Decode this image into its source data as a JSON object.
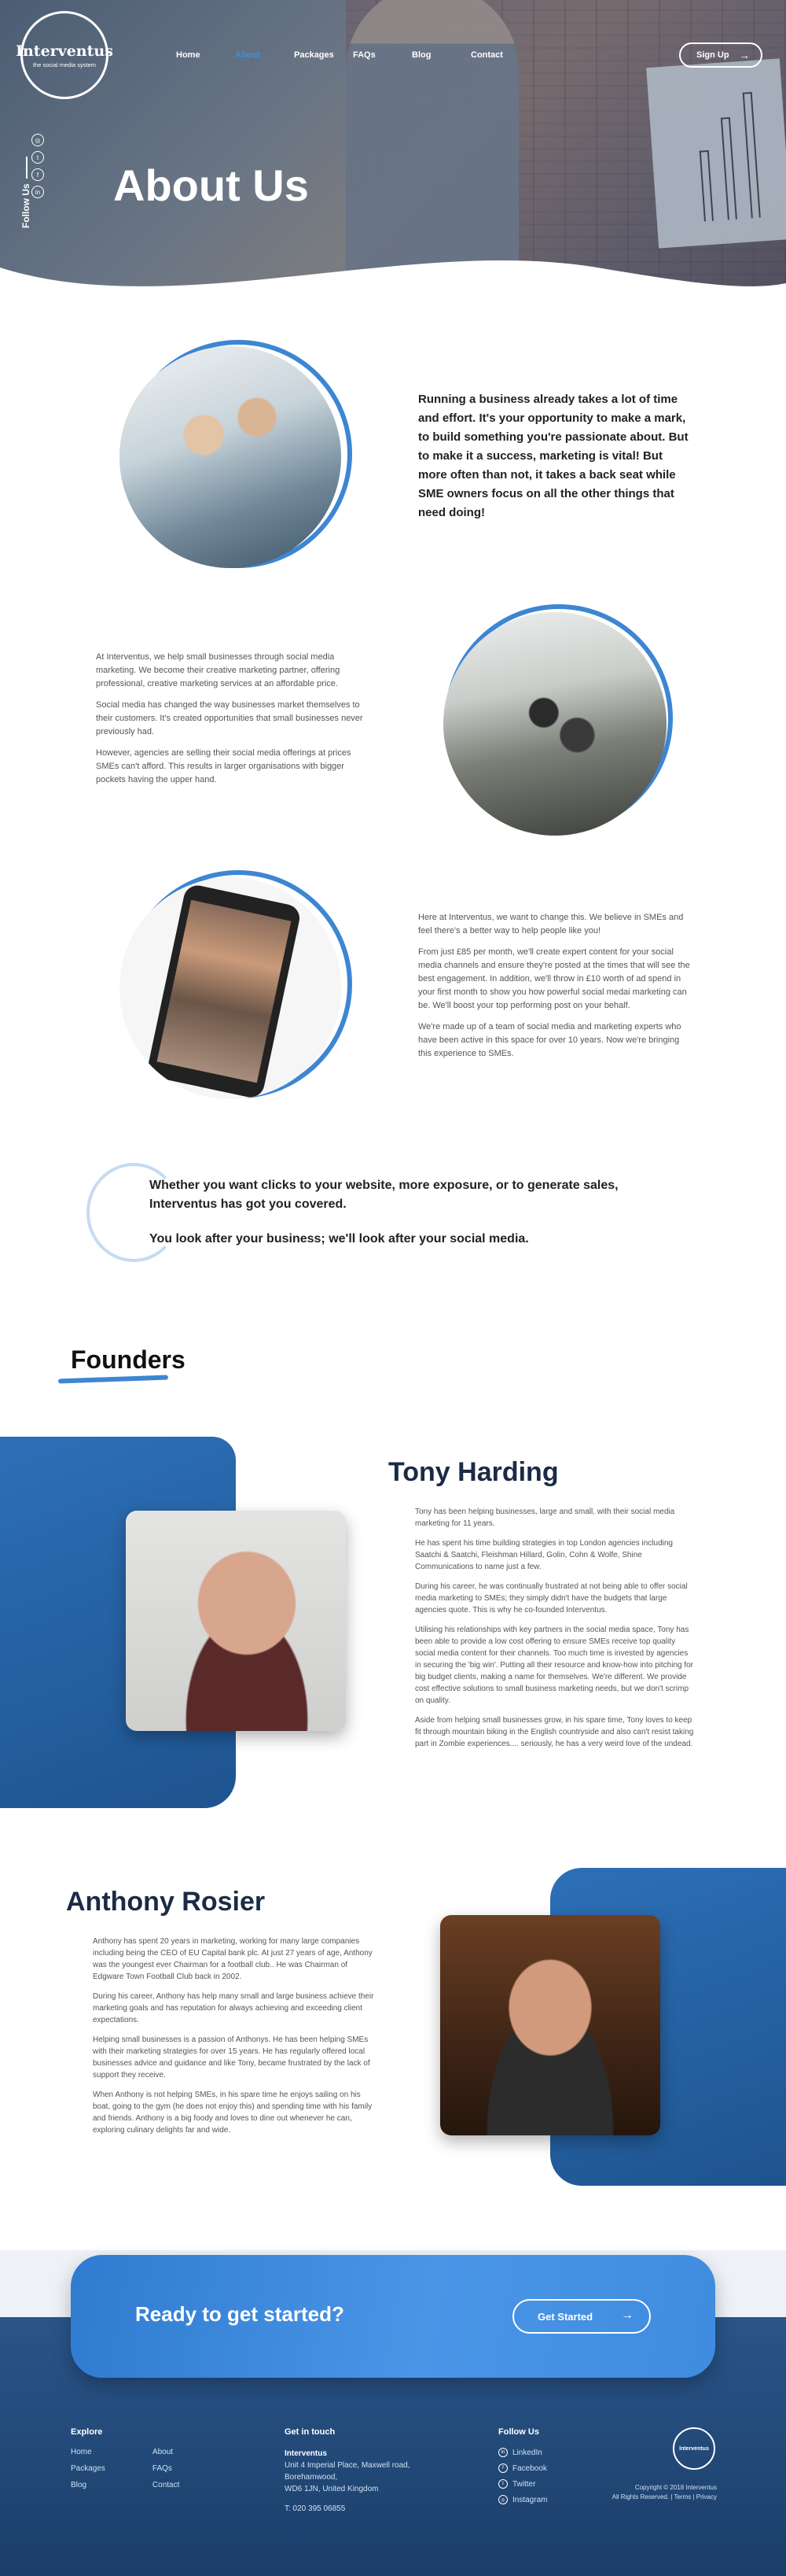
{
  "brand": {
    "name": "Interventus",
    "tagline": "the social media system"
  },
  "nav": [
    "Home",
    "About",
    "Packages",
    "FAQs",
    "Blog",
    "Contact"
  ],
  "nav_active": "About",
  "signup_label": "Sign Up",
  "follow_label": "Follow Us",
  "hero_title": "About Us",
  "intro_lead": "Running a business already takes a lot of time and effort. It's your opportunity to make a mark, to build something you're passionate about. But to make it a success, marketing is vital! But more often than not, it takes a back seat while SME owners focus on all the other things that need doing!",
  "section2": [
    "At Interventus, we help small businesses through social media marketing. We become their creative marketing partner, offering professional, creative marketing services at an affordable price.",
    "Social media has changed the way businesses market themselves to their customers. It's created opportunities that small businesses never previously had.",
    "However, agencies are selling their social media offerings at prices SMEs can't afford. This results in larger organisations with bigger pockets having the upper hand."
  ],
  "section3": [
    "Here at Interventus, we want to change this. We believe in SMEs and feel there's a better way to help people like you!",
    "From just £85 per month, we'll create expert content for your social media channels and ensure they're posted at the times that will see the best engagement. In addition, we'll throw in £10 worth of ad spend in your first month to show you how powerful social medai marketing can be. We'll boost your top performing post on your behalf.",
    "We're made up of a team of social media and marketing experts who have been active in this space for over 10 years. Now we're bringing this experience to SMEs."
  ],
  "quote": [
    "Whether you want clicks to your website, more exposure, or to generate sales, Interventus has got you covered.",
    "You look after your business; we'll look after your social media."
  ],
  "founders_title": "Founders",
  "tony": {
    "name": "Tony Harding",
    "bio": [
      "Tony has been helping businesses, large and small, with their social media marketing for 11 years.",
      "He has spent his time building strategies in top London agencies including Saatchi & Saatchi, Fleishman Hillard, Golin, Cohn & Wolfe, Shine Communications to name just a few.",
      "During his career, he was continually frustrated at not being able to offer social media marketing to SMEs; they simply didn't have the budgets that large agencies quote. This is why he co-founded Interventus.",
      "Utilising his relationships with key partners in the social media space, Tony has been able to provide a low cost offering to ensure SMEs receive top quality social media content for their channels. Too much time is invested by agencies in securing the 'big win'. Putting all their resource and know-how into pitching for big budget clients, making a name for themselves. We're different. We provide cost effective solutions to small business marketing needs, but we don't scrimp on quality.",
      "Aside from helping small businesses grow, in his spare time, Tony loves to keep fit through mountain biking in the English countryside and also can't resist taking part in Zombie experiences.... seriously, he has a very weird love of the undead."
    ]
  },
  "anthony": {
    "name": "Anthony Rosier",
    "bio": [
      "Anthony has spent 20 years in marketing, working for many large companies including being the CEO of EU Capital bank plc. At just 27 years of age, Anthony was the youngest ever Chairman for a football club.. He was Chairman of Edgware Town Football Club back in 2002.",
      "During his career, Anthony has help many small and large business achieve their marketing goals and has reputation for always achieving and exceeding client expectations.",
      "Helping small businesses is a passion of Anthonys. He has been helping SMEs with their marketing strategies for over 15 years. He has regularly offered local businesses advice and guidance and like Tony, became frustrated by the lack of support they receive.",
      "When Anthony is not helping SMEs, in his spare time he enjoys sailing on his boat, going to the gym (he does not enjoy this) and spending time with his family and friends. Anthony is a big foody and loves to dine out whenever he can, exploring culinary delights far and wide."
    ]
  },
  "cta": {
    "title": "Ready to get started?",
    "button": "Get Started"
  },
  "footer": {
    "explore_title": "Explore",
    "explore_col1": [
      "Home",
      "Packages",
      "Blog"
    ],
    "explore_col2": [
      "About",
      "FAQs",
      "Contact"
    ],
    "contact_title": "Get in touch",
    "company": "Interventus",
    "address": [
      "Unit 4 Imperial Place, Maxwell road,",
      "Borehamwood,",
      "WD6 1JN, United Kingdom"
    ],
    "phone": "T: 020 395 06855",
    "follow_title": "Follow Us",
    "social": [
      "LinkedIn",
      "Facebook",
      "Twitter",
      "Instagram"
    ],
    "copyright": "Copyright © 2018 Interventus",
    "rights": "All Rights Reserved.  |  Terms  |  Privacy"
  },
  "colors": {
    "accent": "#3d86d2",
    "navy": "#1b2b45",
    "footer": "#1b3e6a"
  },
  "icons": [
    "instagram-icon",
    "twitter-icon",
    "facebook-icon",
    "linkedin-icon",
    "arrow-right-icon"
  ]
}
